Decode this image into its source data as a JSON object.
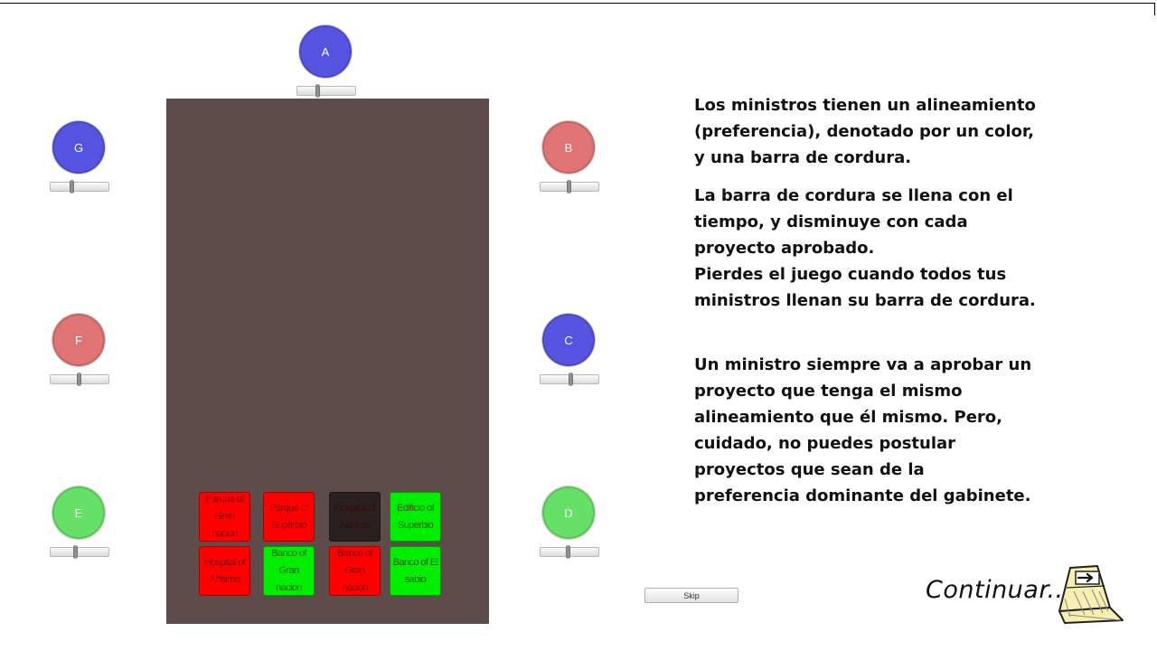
{
  "ministers": [
    {
      "id": "A",
      "label": "A",
      "color": "#5454e0",
      "cordura": 0.35
    },
    {
      "id": "B",
      "label": "B",
      "color": "#e07373",
      "cordura": 0.48
    },
    {
      "id": "C",
      "label": "C",
      "color": "#5454e0",
      "cordura": 0.52
    },
    {
      "id": "D",
      "label": "D",
      "color": "#66e066",
      "cordura": 0.47
    },
    {
      "id": "E",
      "label": "E",
      "color": "#66e066",
      "cordura": 0.42
    },
    {
      "id": "F",
      "label": "F",
      "color": "#e07373",
      "cordura": 0.48
    },
    {
      "id": "G",
      "label": "G",
      "color": "#5454e0",
      "cordura": 0.36
    }
  ],
  "projects": [
    {
      "label": "Parque of Gran nacion",
      "color": "#ff0000"
    },
    {
      "label": "Parque of Superbio",
      "color": "#ff0000"
    },
    {
      "label": "Hospital of Altisimo",
      "color": "#2b2020"
    },
    {
      "label": "Edificio of Superbio",
      "color": "#00ee00"
    },
    {
      "label": "Hospital of Altisimo",
      "color": "#ff0000"
    },
    {
      "label": "Banco of Gran nacion",
      "color": "#00ee00"
    },
    {
      "label": "Banco of Gran nacion",
      "color": "#ff0000"
    },
    {
      "label": "Banco of El sabio",
      "color": "#00ee00"
    }
  ],
  "instructions": {
    "p1": "Los ministros tienen un alineamiento\n(preferencia), denotado por un color,\ny una barra de cordura.",
    "p2": "La barra de cordura se llena con el\ntiempo, y disminuye con cada\nproyecto aprobado.\nPierdes el juego cuando todos tus\nministros llenan su barra de cordura.",
    "p3": "Un ministro siempre va a aprobar un\nproyecto que tenga el mismo\nalineamiento que él mismo. Pero,\ncuidado, no puedes postular\nproyectos que sean de la\npreferencia dominante del gabinete."
  },
  "skip_label": "Skip",
  "continue_label": "Continuar...",
  "continue_icon": "arrow-right-icon"
}
